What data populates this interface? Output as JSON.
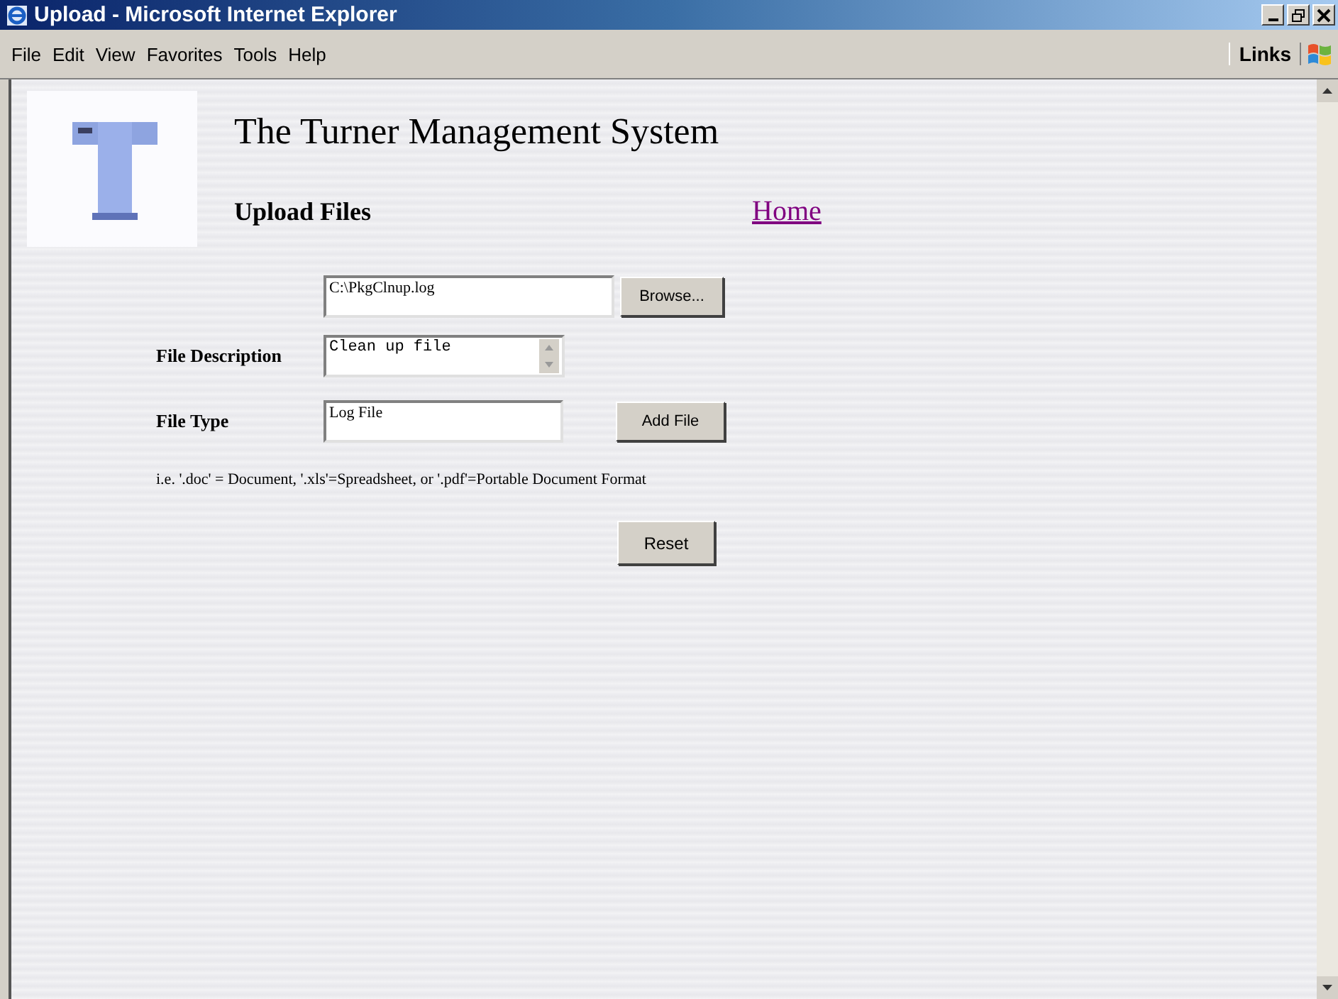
{
  "window": {
    "title": "Upload - Microsoft Internet Explorer"
  },
  "menu": [
    "File",
    "Edit",
    "View",
    "Favorites",
    "Tools",
    "Help"
  ],
  "links_label": "Links",
  "page": {
    "heading": "The Turner Management System",
    "subheading": "Upload Files",
    "home_link": "Home",
    "file_path": {
      "value": "C:\\PkgClnup.log"
    },
    "browse_button": "Browse...",
    "description": {
      "label": "File Description",
      "value": "Clean up file"
    },
    "file_type": {
      "label": "File Type",
      "value": "Log File"
    },
    "add_button": "Add File",
    "hint": "i.e. '.doc' = Document, '.xls'=Spreadsheet, or '.pdf'=Portable Document Format",
    "reset_button": "Reset"
  }
}
